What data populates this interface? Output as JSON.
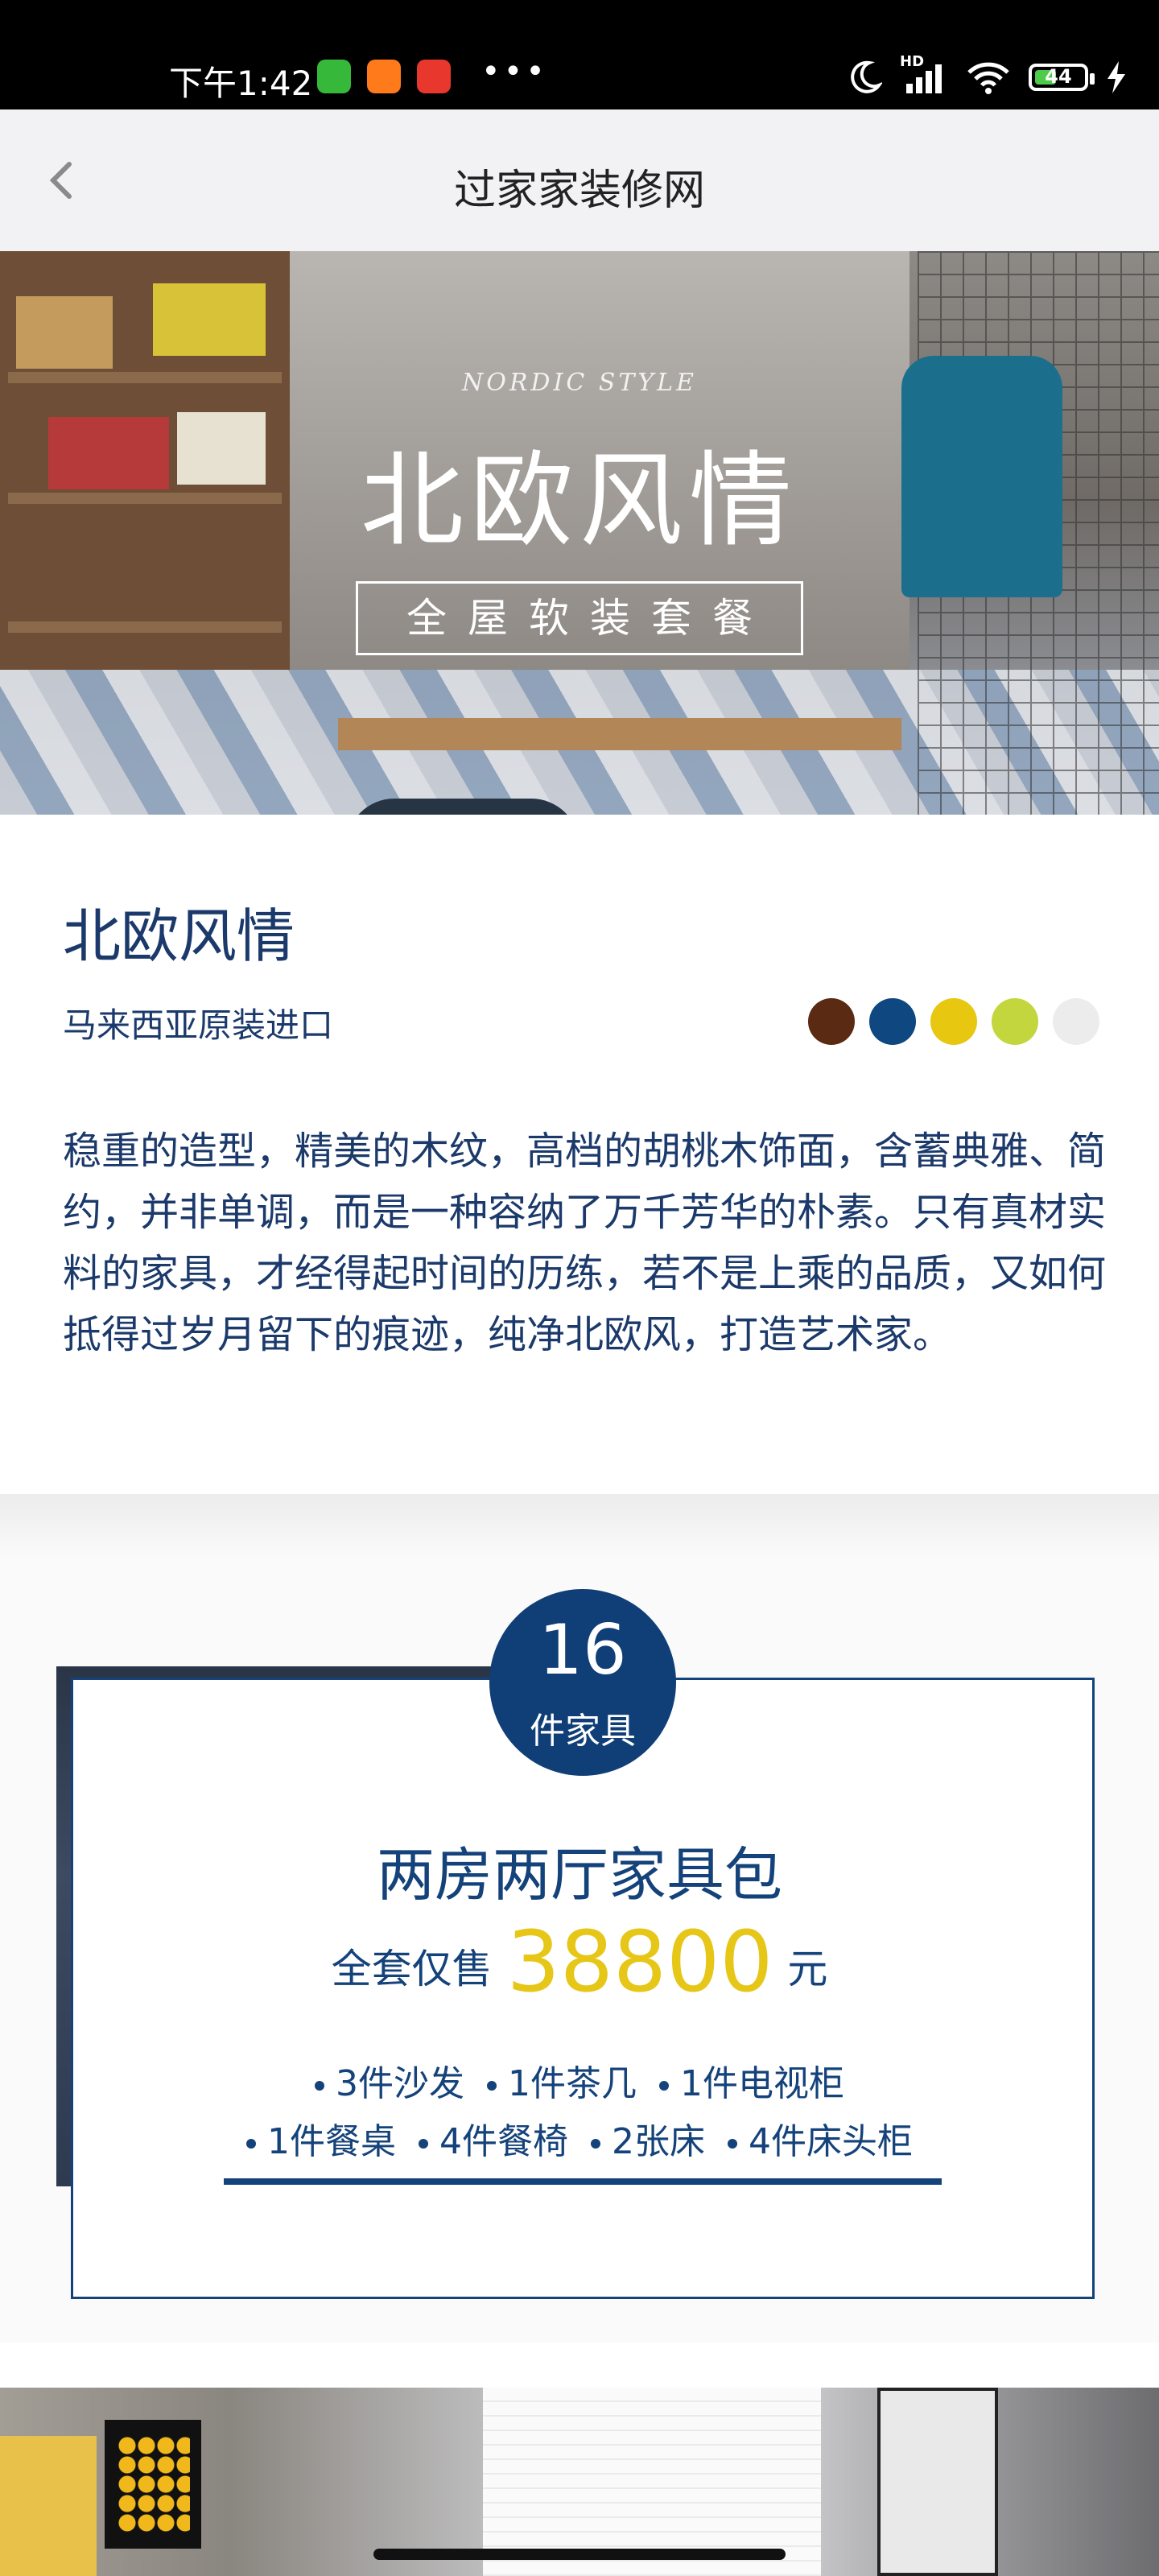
{
  "status_bar": {
    "time": "下午1:42",
    "network_label": "HD",
    "battery": "44",
    "battery_fraction": 0.44,
    "app_icons": [
      "green-app-icon",
      "orange-home-icon",
      "red-app-icon"
    ],
    "more": "•••"
  },
  "nav": {
    "title": "过家家装修网",
    "back_icon": "chevron-left-icon"
  },
  "hero": {
    "eyebrow": "NORDIC STYLE",
    "title": "北欧风情",
    "tag": "全屋软装套餐"
  },
  "product": {
    "title": "北欧风情",
    "origin": "马来西亚原装进口",
    "colors": [
      "#5a2a12",
      "#0f4781",
      "#e7c70f",
      "#c3d63d",
      "#ececec"
    ],
    "description": "稳重的造型，精美的木纹，高档的胡桃木饰面，含蓄典雅、简约，并非单调，而是一种容纳了万千芳华的朴素。只有真材实料的家具，才经得起时间的历练，若不是上乘的品质，又如何抵得过岁月留下的痕迹，纯净北欧风，打造艺术家。"
  },
  "package": {
    "count": "16",
    "count_label": "件家具",
    "name": "两房两厅家具包",
    "price_prefix": "全套仅售",
    "price": "38800",
    "price_unit": "元",
    "items_row1": [
      "3件沙发",
      "1件茶几",
      "1件电视柜"
    ],
    "items_row2": [
      "1件餐桌",
      "4件餐椅",
      "2张床",
      "4件床头柜"
    ],
    "accent_color": "#14427a",
    "price_color": "#e6c617"
  }
}
